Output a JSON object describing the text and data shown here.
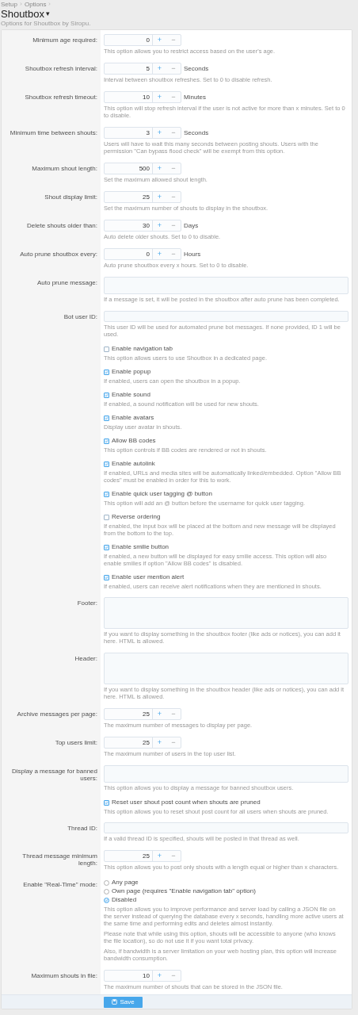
{
  "breadcrumb": [
    "Setup",
    "Options"
  ],
  "title": "Shoutbox",
  "title_caret": "▾",
  "subtitle": "Options for Shoutbox by Siropu.",
  "options": [
    {
      "kind": "number",
      "label": "Minimum age required:",
      "value": "0",
      "description": "This option allows you to restrict access based on the user's age."
    },
    {
      "kind": "number",
      "label": "Shoutbox refresh interval:",
      "value": "5",
      "unit": "Seconds",
      "description": "Interval between shoutbox refreshes. Set to 0 to disable refresh."
    },
    {
      "kind": "number",
      "label": "Shoutbox refresh timeout:",
      "value": "10",
      "unit": "Minutes",
      "description": "This option will stop refresh interval if the user is not active for more than x minutes. Set to 0 to disable."
    },
    {
      "kind": "number",
      "label": "Minimum time between shouts:",
      "value": "3",
      "unit": "Seconds",
      "description": "Users will have to wait this many seconds between posting shouts. Users with the permission \"Can bypass flood check\" will be exempt from this option."
    },
    {
      "kind": "number",
      "label": "Maximum shout length:",
      "value": "500",
      "description": "Set the maximum allowed shout length."
    },
    {
      "kind": "number",
      "label": "Shout display limit:",
      "value": "25",
      "description": "Set the maximum number of shouts to display in the shoutbox."
    },
    {
      "kind": "number",
      "label": "Delete shouts older than:",
      "value": "30",
      "unit": "Days",
      "description": "Auto delete older shouts. Set to 0 to disable."
    },
    {
      "kind": "number",
      "label": "Auto prune shoutbox every:",
      "value": "0",
      "unit": "Hours",
      "description": "Auto prune shoutbox every x hours. Set to 0 to disable."
    },
    {
      "kind": "textarea",
      "label": "Auto prune message:",
      "description": "If a message is set, it will be posted in the shoutbox after auto prune has been completed."
    },
    {
      "kind": "text",
      "label": "Bot user ID:",
      "description": "This user ID will be used for automated prune bot messages. If none provided, ID 1 will be used."
    },
    {
      "kind": "checkbox",
      "label": "Enable navigation tab",
      "checked": false,
      "description": "This option allows users to use Shoutbox in a dedicated page."
    },
    {
      "kind": "checkbox",
      "label": "Enable popup",
      "checked": true,
      "description": "If enabled, users can open the shoutbox in a popup."
    },
    {
      "kind": "checkbox",
      "label": "Enable sound",
      "checked": true,
      "description": "If enabled, a sound notification will be used for new shouts."
    },
    {
      "kind": "checkbox",
      "label": "Enable avatars",
      "checked": true,
      "description": "Display user avatar in shouts."
    },
    {
      "kind": "checkbox",
      "label": "Allow BB codes",
      "checked": true,
      "description": "This option controls if BB codes are rendered or not in shouts."
    },
    {
      "kind": "checkbox",
      "label": "Enable autolink",
      "checked": true,
      "description": "If enabled, URLs and media sites will be automatically linked/embedded. Option \"Allow BB codes\" must be enabled in order for this to work."
    },
    {
      "kind": "checkbox",
      "label": "Enable quick user tagging @ button",
      "checked": true,
      "description": "This option will add an @ button before the username for quick user tagging."
    },
    {
      "kind": "checkbox",
      "label": "Reverse ordering",
      "checked": false,
      "description": "If enabled, the input box will be placed at the bottom and new message will be displayed from the bottom to the top."
    },
    {
      "kind": "checkbox",
      "label": "Enable smilie button",
      "checked": true,
      "description": "If enabled, a new button will be displayed for easy smilie access. This option will also enable smilies if option \"Allow BB codes\" is disabled."
    },
    {
      "kind": "checkbox",
      "label": "Enable user mention alert",
      "checked": true,
      "description": "If enabled, users can receive alert notifications when they are mentioned in shouts."
    },
    {
      "kind": "editor",
      "label": "Footer:",
      "description": "If you want to display something in the shoutbox footer (like ads or notices), you can add it here. HTML is allowed."
    },
    {
      "kind": "editor",
      "label": "Header:",
      "description": "If you want to display something in the shoutbox header (like ads or notices), you can add it here. HTML is allowed."
    },
    {
      "kind": "number",
      "label": "Archive messages per page:",
      "value": "25",
      "description": "The maximum number of messages to display per page."
    },
    {
      "kind": "number",
      "label": "Top users limit:",
      "value": "25",
      "description": "The maximum number of users in the top user list."
    },
    {
      "kind": "textarea",
      "label": "Display a message for banned users:",
      "description": "This option allows you to display a message for banned shoutbox users."
    },
    {
      "kind": "checkbox",
      "label": "Reset user shout post count when shouts are pruned",
      "checked": true,
      "description": "This option allows you to reset shout post count for all users when shouts are pruned."
    },
    {
      "kind": "text",
      "label": "Thread ID:",
      "description": "If a valid thread ID is specified, shouts will be posted in that thread as well."
    },
    {
      "kind": "number",
      "label": "Thread message minimum length:",
      "value": "25",
      "description": "This option allows you to post only shouts with a length equal or higher than x characters."
    },
    {
      "kind": "radio",
      "label": "Enable \"Real-Time\" mode:",
      "choices": [
        {
          "label": "Any page",
          "selected": false
        },
        {
          "label": "Own page (requires \"Enable navigation tab\" option)",
          "selected": false
        },
        {
          "label": "Disabled",
          "selected": true
        }
      ],
      "paragraphs": [
        "This option allows you to improve performance and server load by calling a JSON file on the server instead of querying the database every x seconds, handling more active users at the same time and performing edits and deletes almost instantly.",
        "Please note that while using this option, shouts will be accessible to anyone (who knows the file location), so do not use it if you want total privacy.",
        "Also, if bandwidth is a server limitation on your web hosting plan, this option will increase bandwidth consumption."
      ]
    },
    {
      "kind": "number",
      "label": "Maximum shouts in file:",
      "value": "10",
      "description": "The maximum number of shouts that can be stored in the JSON file."
    }
  ],
  "plus": "+",
  "minus": "−",
  "save_button": "Save"
}
